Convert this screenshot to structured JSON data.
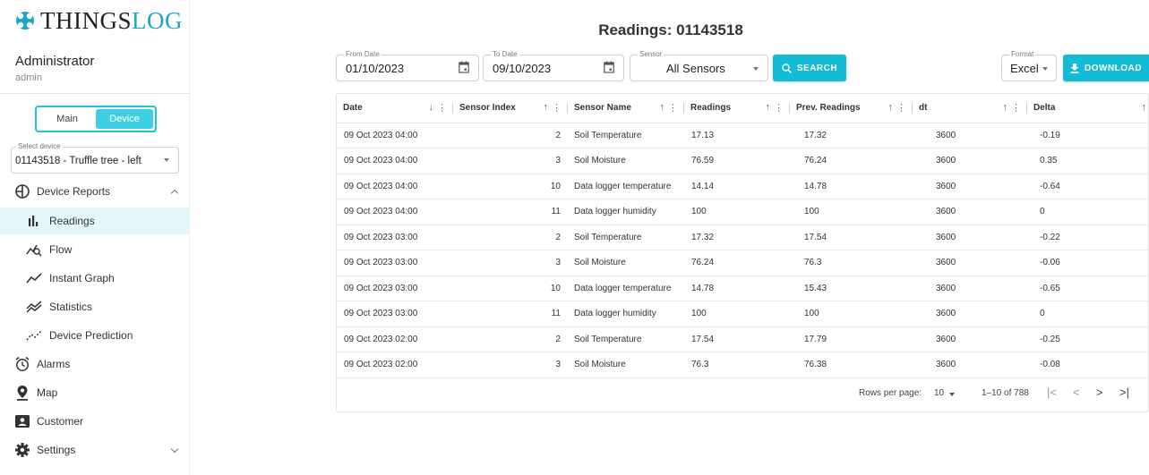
{
  "brand": {
    "thin": "THINGS",
    "accent": "LOG",
    "accent_color": "#1aa7c4"
  },
  "user": {
    "name": "Administrator",
    "role": "admin"
  },
  "mode_toggle": {
    "main": "Main",
    "device": "Device",
    "active": "Device"
  },
  "device_select": {
    "label": "Select device",
    "value": "01143518 - Truffle tree - left"
  },
  "nav": {
    "device_reports": "Device Reports",
    "readings": "Readings",
    "flow": "Flow",
    "instant_graph": "Instant Graph",
    "statistics": "Statistics",
    "device_prediction": "Device Prediction",
    "alarms": "Alarms",
    "map": "Map",
    "customer": "Customer",
    "settings": "Settings"
  },
  "page_title": "Readings: 01143518",
  "filters": {
    "from_label": "From Date",
    "from_value": "01/10/2023",
    "to_label": "To Date",
    "to_value": "09/10/2023",
    "sensor_label": "Sensor",
    "sensor_value": "All Sensors",
    "search_label": "SEARCH",
    "format_label": "Format",
    "format_value": "Excel",
    "download_label": "DOWNLOAD"
  },
  "table": {
    "headers": [
      "Date",
      "Sensor Index",
      "Sensor Name",
      "Readings",
      "Prev. Readings",
      "dt",
      "Delta"
    ],
    "rows": [
      [
        "09 Oct 2023 04:00",
        "2",
        "Soil Temperature",
        "17.13",
        "17.32",
        "3600",
        "-0.19"
      ],
      [
        "09 Oct 2023 04:00",
        "3",
        "Soil Moisture",
        "76.59",
        "76.24",
        "3600",
        "0.35"
      ],
      [
        "09 Oct 2023 04:00",
        "10",
        "Data logger temperature",
        "14.14",
        "14.78",
        "3600",
        "-0.64"
      ],
      [
        "09 Oct 2023 04:00",
        "11",
        "Data logger humidity",
        "100",
        "100",
        "3600",
        "0"
      ],
      [
        "09 Oct 2023 03:00",
        "2",
        "Soil Temperature",
        "17.32",
        "17.54",
        "3600",
        "-0.22"
      ],
      [
        "09 Oct 2023 03:00",
        "3",
        "Soil Moisture",
        "76.24",
        "76.3",
        "3600",
        "-0.06"
      ],
      [
        "09 Oct 2023 03:00",
        "10",
        "Data logger temperature",
        "14.78",
        "15.43",
        "3600",
        "-0.65"
      ],
      [
        "09 Oct 2023 03:00",
        "11",
        "Data logger humidity",
        "100",
        "100",
        "3600",
        "0"
      ],
      [
        "09 Oct 2023 02:00",
        "2",
        "Soil Temperature",
        "17.54",
        "17.79",
        "3600",
        "-0.25"
      ],
      [
        "09 Oct 2023 02:00",
        "3",
        "Soil Moisture",
        "76.3",
        "76.38",
        "3600",
        "-0.08"
      ]
    ]
  },
  "pagination": {
    "rows_per_page_label": "Rows per page:",
    "rows_per_page": "10",
    "range": "1–10 of 788"
  },
  "colors": {
    "accent": "#12bcd6",
    "active_nav_bg": "#e3f7fb"
  }
}
